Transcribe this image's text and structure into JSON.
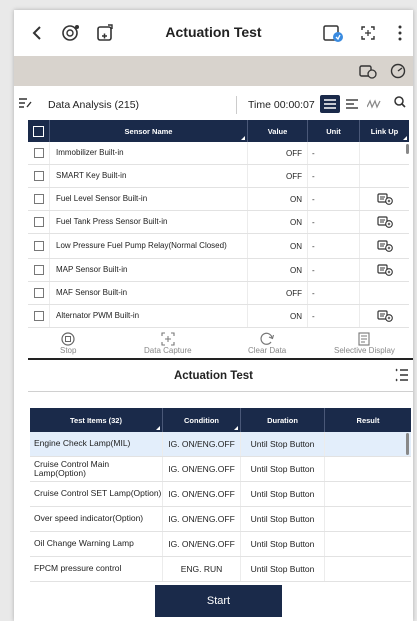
{
  "header": {
    "title": "Actuation Test",
    "icons": [
      "back-icon",
      "vehicle-settings-icon",
      "car-plus-icon",
      "calendar-icon",
      "fullscreen-icon",
      "more-icon"
    ]
  },
  "data_analysis": {
    "label": "Data Analysis (215)",
    "time": "Time 00:00:07"
  },
  "sensor_table": {
    "headers": {
      "name": "Sensor Name",
      "value": "Value",
      "unit": "Unit",
      "link": "Link Up"
    },
    "rows": [
      {
        "name": "Immobilizer Built-in",
        "value": "OFF",
        "unit": "-",
        "link": false
      },
      {
        "name": "SMART Key Built-in",
        "value": "OFF",
        "unit": "-",
        "link": false
      },
      {
        "name": "Fuel Level Sensor Built-in",
        "value": "ON",
        "unit": "-",
        "link": true
      },
      {
        "name": "Fuel Tank Press Sensor Built-in",
        "value": "ON",
        "unit": "-",
        "link": true
      },
      {
        "name": "Low Pressure Fuel Pump Relay(Normal Closed)",
        "value": "ON",
        "unit": "-",
        "link": true
      },
      {
        "name": "MAP Sensor Built-in",
        "value": "ON",
        "unit": "-",
        "link": true
      },
      {
        "name": "MAF Sensor Built-in",
        "value": "OFF",
        "unit": "-",
        "link": false
      },
      {
        "name": "Alternator PWM Built-in",
        "value": "ON",
        "unit": "-",
        "link": true
      }
    ]
  },
  "actions": {
    "stop": "Stop",
    "capture": "Data Capture",
    "clear": "Clear Data",
    "selective": "Selective Display"
  },
  "actuation": {
    "title": "Actuation Test",
    "headers": {
      "item": "Test Items (32)",
      "condition": "Condition",
      "duration": "Duration",
      "result": "Result"
    },
    "rows": [
      {
        "item": "Engine Check Lamp(MIL)",
        "condition": "IG. ON/ENG.OFF",
        "duration": "Until Stop Button",
        "result": ""
      },
      {
        "item": "Cruise Control Main Lamp(Option)",
        "condition": "IG. ON/ENG.OFF",
        "duration": "Until Stop Button",
        "result": ""
      },
      {
        "item": "Cruise Control SET Lamp(Option)",
        "condition": "IG. ON/ENG.OFF",
        "duration": "Until Stop Button",
        "result": ""
      },
      {
        "item": "Over speed indicator(Option)",
        "condition": "IG. ON/ENG.OFF",
        "duration": "Until Stop Button",
        "result": ""
      },
      {
        "item": "Oil Change Warning Lamp",
        "condition": "IG. ON/ENG.OFF",
        "duration": "Until Stop Button",
        "result": ""
      },
      {
        "item": "FPCM pressure control",
        "condition": "ENG. RUN",
        "duration": "Until Stop Button",
        "result": ""
      }
    ],
    "start_label": "Start"
  },
  "colors": {
    "header_bg": "#1a2a4a",
    "selected_row": "#e3eefb",
    "toolbar_gray": "#d8d3cd"
  }
}
